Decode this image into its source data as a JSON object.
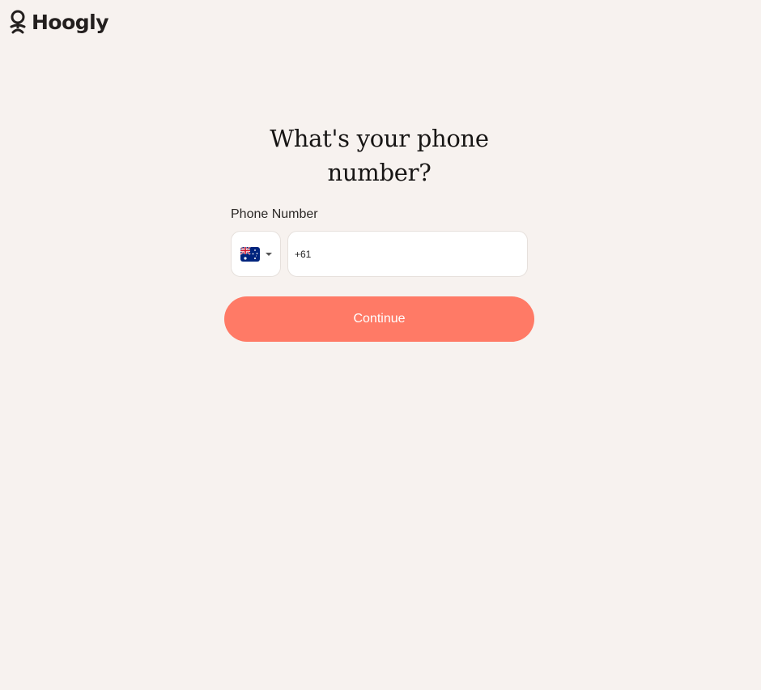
{
  "brand": {
    "name": "Hoogly",
    "logo_icon": "hoogly-logo-icon"
  },
  "form": {
    "heading": "What's your phone number?",
    "phone_label": "Phone Number",
    "country": {
      "flag_icon": "australia-flag-icon",
      "dial_code": "+61"
    },
    "phone_value": "+61",
    "continue_label": "Continue"
  },
  "colors": {
    "background": "#f7f2ef",
    "button": "#ff7a66",
    "button_text": "#ffffff",
    "input_bg": "#ffffff"
  }
}
